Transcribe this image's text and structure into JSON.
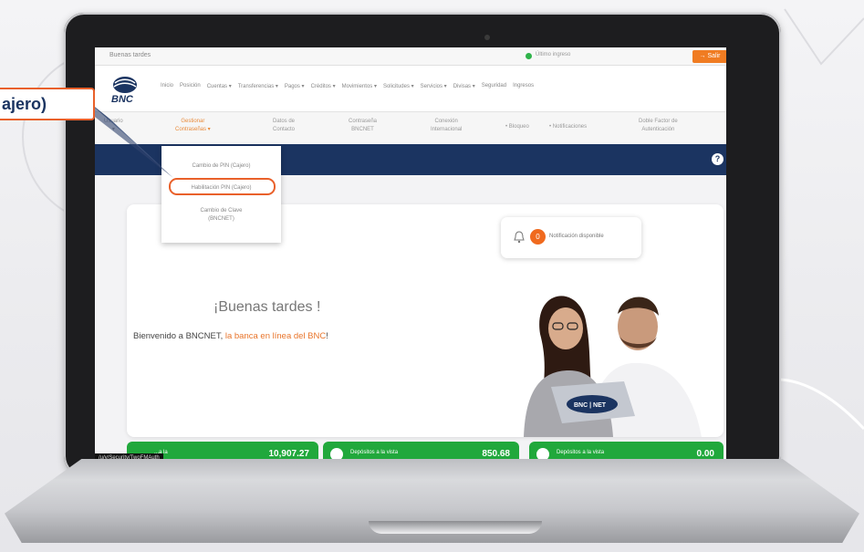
{
  "window": {
    "top_greeting": "Buenas tardes",
    "connection_status": "Último ingreso",
    "exit_label": "Salir"
  },
  "navbar": {
    "brand": "BNC",
    "items": [
      "Inicio",
      "Posición",
      "Cuentas ▾",
      "Transferencias ▾",
      "Pagos ▾",
      "Créditos ▾",
      "Movimientos ▾",
      "Solicitudes ▾",
      "Servicios ▾",
      "Divisas ▾",
      "Seguridad",
      "Ingresos"
    ]
  },
  "subnav": {
    "items": [
      "Usuario\n▾",
      "Gestionar\nContraseñas ▾",
      "Datos de\nContacto",
      "Contraseña\nBNCNET",
      "Conexión\nInternacional",
      "• Bloqueo",
      "• Notificaciones",
      "Doble Factor de\nAutenticación"
    ]
  },
  "dropdown": {
    "items": [
      "Cambio de PIN (Cajero)",
      "Habilitación PIN (Cajero)",
      "Cambio de Clave\n(BNCNET)"
    ]
  },
  "main": {
    "greeting": "¡Buenas tardes !",
    "welcome_prefix": "Bienvenido a BNCNET, ",
    "welcome_highlight": "la banca en línea del BNC",
    "welcome_suffix": "!",
    "notification_count": "0",
    "notification_label": "Notificación disponible",
    "card_logo_text": "BNC | NET"
  },
  "summary": [
    {
      "label": "...a la",
      "value": "10,907.27"
    },
    {
      "label": "Depósitos a la vista",
      "value": "850.68"
    },
    {
      "label": "Depósitos a la vista",
      "value": "0.00"
    }
  ],
  "url_tooltip": "/u/y/Security/TwoFMAuth",
  "callout": {
    "label": "ajero)"
  },
  "colors": {
    "accent": "#e9602a",
    "navy": "#1b3461",
    "green": "#21a83c"
  }
}
